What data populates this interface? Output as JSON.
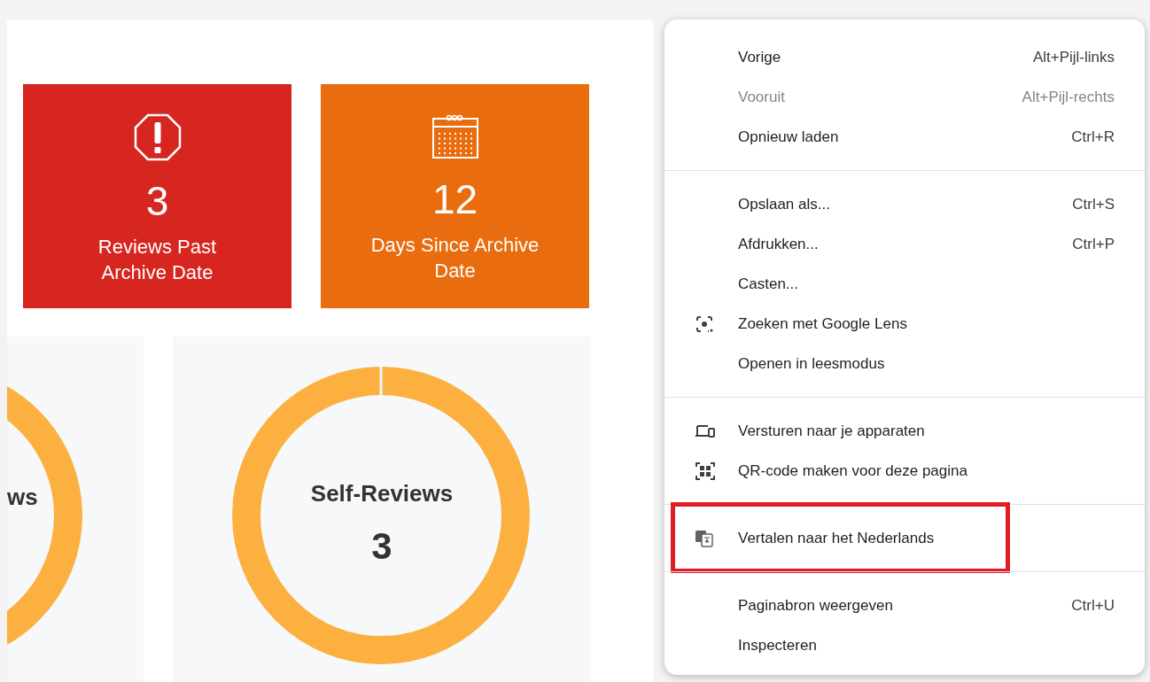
{
  "stat_tiles": [
    {
      "kind": "alert",
      "value": "3",
      "label": "Reviews Past Archive Date",
      "color": "#d6261f"
    },
    {
      "kind": "calendar",
      "value": "12",
      "label": "Days Since Archive Date",
      "color": "#e96c0e"
    }
  ],
  "donut_cards": [
    {
      "title": "ws"
    },
    {
      "title": "Self-Reviews",
      "value": "3"
    }
  ],
  "context_menu": {
    "groups": [
      {
        "items": [
          {
            "label": "Vorige",
            "shortcut": "Alt+Pijl-links",
            "disabled": false,
            "marked": false
          },
          {
            "label": "Vooruit",
            "shortcut": "Alt+Pijl-rechts",
            "disabled": true,
            "marked": false
          },
          {
            "label": "Opnieuw laden",
            "shortcut": "Ctrl+R",
            "disabled": false,
            "marked": false
          }
        ]
      },
      {
        "items": [
          {
            "label": "Opslaan als...",
            "shortcut": "Ctrl+S",
            "disabled": false,
            "marked": false
          },
          {
            "label": "Afdrukken...",
            "shortcut": "Ctrl+P",
            "disabled": false,
            "marked": false
          },
          {
            "label": "Casten...",
            "disabled": false,
            "marked": false
          },
          {
            "label": "Zoeken met Google Lens",
            "kind": "lens",
            "disabled": false,
            "marked": false
          },
          {
            "label": "Openen in leesmodus",
            "disabled": false,
            "marked": false
          }
        ]
      },
      {
        "items": [
          {
            "label": "Versturen naar je apparaten",
            "kind": "devices",
            "disabled": false,
            "marked": false
          },
          {
            "label": "QR-code maken voor deze pagina",
            "kind": "qr",
            "disabled": false,
            "marked": false
          }
        ]
      },
      {
        "items": [
          {
            "label": "Vertalen naar het Nederlands",
            "kind": "translate",
            "disabled": false,
            "marked": true
          }
        ]
      },
      {
        "items": [
          {
            "label": "Paginabron weergeven",
            "shortcut": "Ctrl+U",
            "disabled": false,
            "marked": false
          },
          {
            "label": "Inspecteren",
            "disabled": false,
            "marked": false
          }
        ]
      }
    ]
  }
}
